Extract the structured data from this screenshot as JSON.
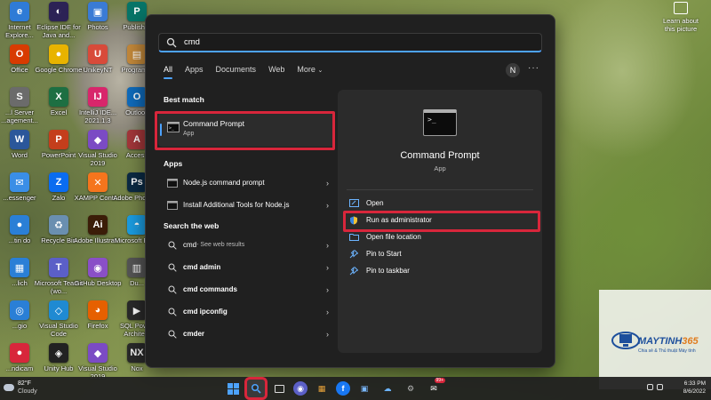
{
  "desktop": {
    "icons": [
      {
        "label": "Internet Explore...",
        "glyph": "e",
        "color": "#2f7bd6"
      },
      {
        "label": "Eclipse IDE for Java and...",
        "glyph": "◐",
        "color": "#2c2255"
      },
      {
        "label": "Photos",
        "glyph": "▣",
        "color": "#3a7bd5"
      },
      {
        "label": "Publisher",
        "glyph": "P",
        "color": "#077568"
      },
      {
        "label": "Office",
        "glyph": "O",
        "color": "#d83b01"
      },
      {
        "label": "Google Chrome",
        "glyph": "●",
        "color": "#e8b300"
      },
      {
        "label": "UnikeyNT",
        "glyph": "U",
        "color": "#d84a3a"
      },
      {
        "label": "Program...",
        "glyph": "▤",
        "color": "#c4893a"
      },
      {
        "label": "...l Server ...agement...",
        "glyph": "S",
        "color": "#6b6b6b"
      },
      {
        "label": "Excel",
        "glyph": "X",
        "color": "#1d6f42"
      },
      {
        "label": "IntelliJ IDE... 2021.1.3",
        "glyph": "IJ",
        "color": "#d8266b"
      },
      {
        "label": "Outlook",
        "glyph": "O",
        "color": "#0f6cbd"
      },
      {
        "label": "Word",
        "glyph": "W",
        "color": "#2b579a"
      },
      {
        "label": "PowerPoint",
        "glyph": "P",
        "color": "#c43e1c"
      },
      {
        "label": "Visual Studio 2019",
        "glyph": "◆",
        "color": "#7b4bc4"
      },
      {
        "label": "Access",
        "glyph": "A",
        "color": "#a4373a"
      },
      {
        "label": "...essenger",
        "glyph": "✉",
        "color": "#3a8ee6"
      },
      {
        "label": "Zalo",
        "glyph": "Z",
        "color": "#0a6cf0"
      },
      {
        "label": "XAMPP Contr...",
        "glyph": "✕",
        "color": "#f5751d"
      },
      {
        "label": "Adobe Photos...",
        "glyph": "Ps",
        "color": "#0b2a44"
      },
      {
        "label": "...tin do",
        "glyph": "●",
        "color": "#2a7fd6"
      },
      {
        "label": "Recycle Bin",
        "glyph": "♻",
        "color": "#6a8fb0"
      },
      {
        "label": "Adobe Illustrat...",
        "glyph": "Ai",
        "color": "#3b1d08"
      },
      {
        "label": "Microsoft Edge",
        "glyph": "◓",
        "color": "#1b9de2"
      },
      {
        "label": "...lich",
        "glyph": "▦",
        "color": "#2a7fd6"
      },
      {
        "label": "Microsoft Teams (wo...",
        "glyph": "T",
        "color": "#5b5fc7"
      },
      {
        "label": "GitHub Desktop",
        "glyph": "◉",
        "color": "#8a4fc7"
      },
      {
        "label": "Du...",
        "glyph": "▥",
        "color": "#555555"
      },
      {
        "label": "...gio",
        "glyph": "◎",
        "color": "#2a7fd6"
      },
      {
        "label": "Visual Studio Code",
        "glyph": "◇",
        "color": "#1f8ad2"
      },
      {
        "label": "Firefox",
        "glyph": "◕",
        "color": "#e66000"
      },
      {
        "label": "SQL Power Architect",
        "glyph": "▶",
        "color": "#2a2a2a"
      },
      {
        "label": "...ndicam",
        "glyph": "●",
        "color": "#d8263b"
      },
      {
        "label": "Unity Hub",
        "glyph": "◈",
        "color": "#222222"
      },
      {
        "label": "Visual Studio 2019",
        "glyph": "◆",
        "color": "#7b4bc4"
      },
      {
        "label": "Nox",
        "glyph": "NX",
        "color": "#2a2a2a"
      }
    ],
    "learn_label": "Learn about this picture"
  },
  "search": {
    "query": "cmd",
    "tabs": [
      "All",
      "Apps",
      "Documents",
      "Web",
      "More"
    ],
    "avatar_initial": "N"
  },
  "results": {
    "best_match_heading": "Best match",
    "best_match": {
      "name": "Command Prompt",
      "type": "App"
    },
    "apps_heading": "Apps",
    "apps": [
      "Node.js command prompt",
      "Install Additional Tools for Node.js"
    ],
    "web_heading": "Search the web",
    "web": [
      {
        "term": "cmd",
        "suffix": " - See web results"
      },
      {
        "term": "cmd admin",
        "suffix": ""
      },
      {
        "term": "cmd commands",
        "suffix": ""
      },
      {
        "term": "cmd ipconfig",
        "suffix": ""
      },
      {
        "term": "cmder",
        "suffix": ""
      }
    ]
  },
  "detail": {
    "title": "Command Prompt",
    "subtitle": "App",
    "actions": [
      "Open",
      "Run as administrator",
      "Open file location",
      "Pin to Start",
      "Pin to taskbar"
    ]
  },
  "watermark": {
    "brand_main": "MAYTINH",
    "brand_accent": "365",
    "tagline": "Chia sẻ & Thủ thuật Máy tính"
  },
  "taskbar": {
    "weather_temp": "82°F",
    "weather_cond": "Cloudy",
    "time": "6:33 PM",
    "date": "8/6/2022",
    "notif_badge": "99+"
  },
  "colors": {
    "accent": "#4da3ff",
    "highlight": "#d8263b",
    "panel_bg": "#202020"
  }
}
